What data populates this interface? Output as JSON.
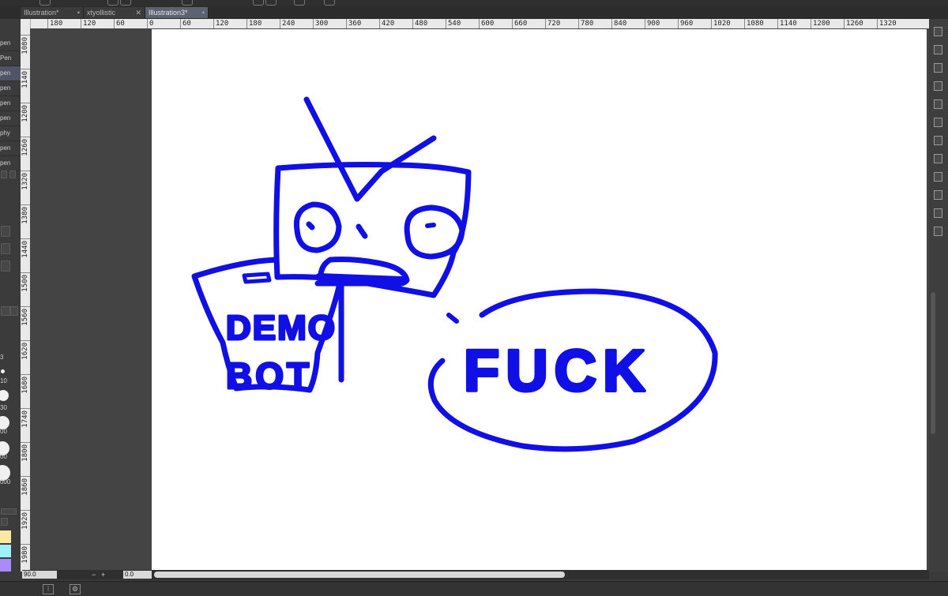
{
  "tabs": [
    {
      "label": "Illustration*",
      "close": "•",
      "active": false
    },
    {
      "label": "xtyollistic",
      "close": "✕",
      "active": false
    },
    {
      "label": "Illustration3*",
      "close": "•",
      "active": true
    }
  ],
  "ruler_h_labels": [
    "180",
    "120",
    "60",
    "0",
    "60",
    "120",
    "180",
    "240",
    "300",
    "360",
    "420",
    "480",
    "540",
    "600",
    "660",
    "720",
    "780",
    "840",
    "900",
    "960",
    "1020",
    "1080",
    "1140",
    "1200",
    "1260",
    "1320"
  ],
  "ruler_v_labels": [
    "1080",
    "1140",
    "1200",
    "1260",
    "1320",
    "1380",
    "1440",
    "1500",
    "1560",
    "1620",
    "1680",
    "1740",
    "1800",
    "1860",
    "1920",
    "1980"
  ],
  "brush_list": [
    "pen",
    "Pen",
    "pen",
    "pen",
    "pen",
    "pen",
    "phy",
    "pen",
    "pen"
  ],
  "size_labels": [
    "3",
    "10",
    "30",
    "00",
    "00",
    "000"
  ],
  "swatch_colors": [
    "#ffe9a0",
    "#9df2f7",
    "#a98bff"
  ],
  "status": {
    "zoom": "90.0",
    "angle": "0.0",
    "zoom_minus": "−",
    "zoom_plus": "+"
  },
  "drawing": {
    "stroke_color": "#1010e6",
    "sign_text_line1": "DEMO",
    "sign_text_line2": "BOT",
    "bubble_text": "FUCK"
  },
  "icons": [
    "pen-icon",
    "layer-icon",
    "history-icon",
    "navigator-icon",
    "color-icon",
    "sub-tool-icon",
    "material-icon",
    "property-icon",
    "search-icon",
    "info-icon",
    "pallet-icon",
    "layer-property-icon"
  ]
}
